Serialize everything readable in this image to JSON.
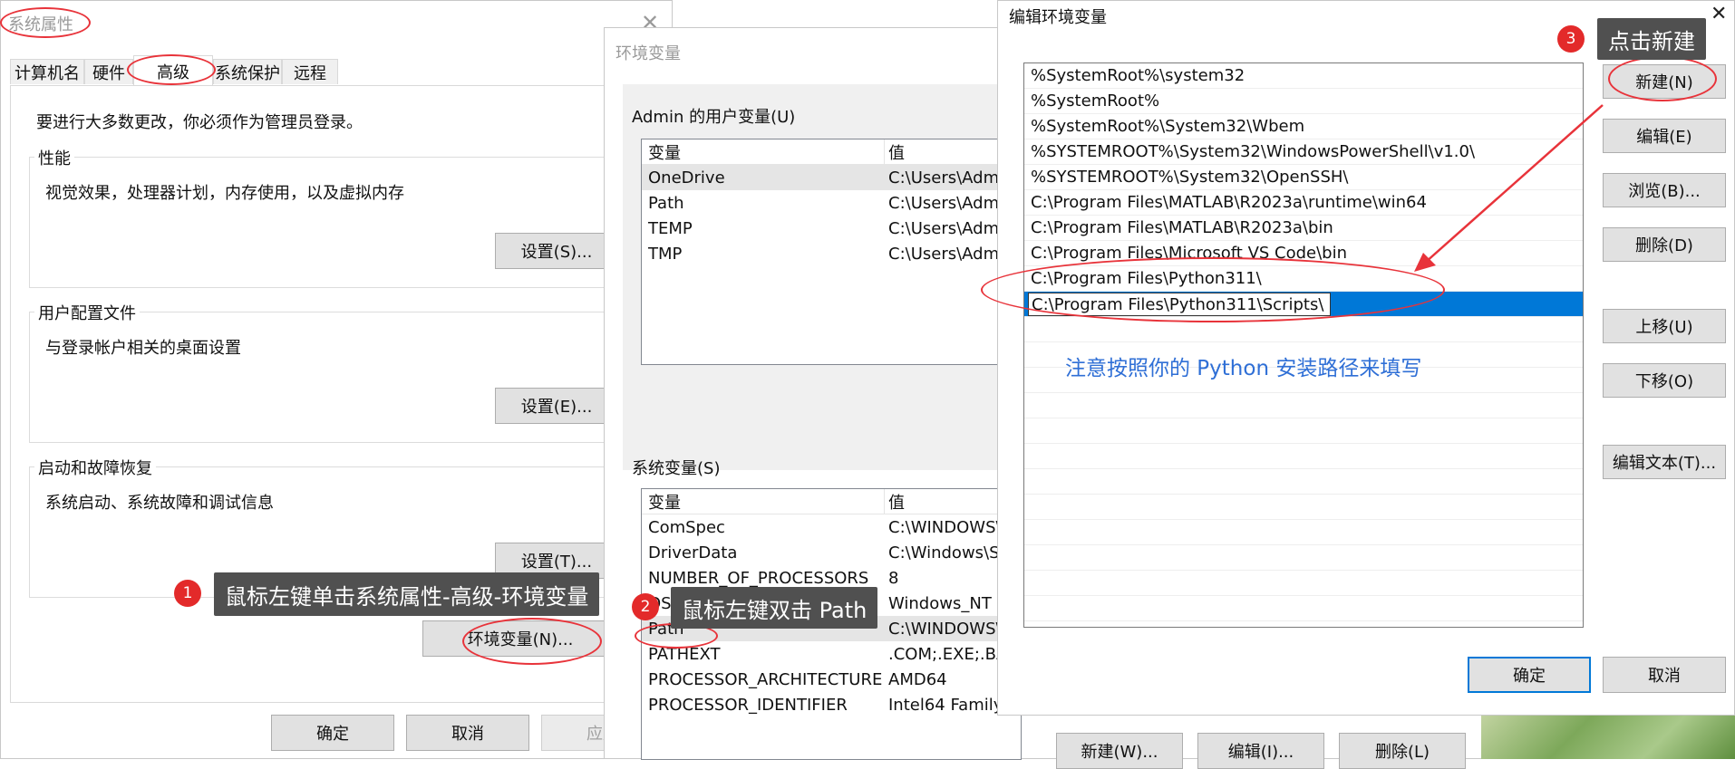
{
  "sysprops": {
    "title": "系统属性",
    "tabs": [
      "计算机名",
      "硬件",
      "高级",
      "系统保护",
      "远程"
    ],
    "admin_note": "要进行大多数更改，你必须作为管理员登录。",
    "perf_label": "性能",
    "perf_desc": "视觉效果，处理器计划，内存使用，以及虚拟内存",
    "perf_btn": "设置(S)...",
    "profile_label": "用户配置文件",
    "profile_desc": "与登录帐户相关的桌面设置",
    "profile_btn": "设置(E)...",
    "startup_label": "启动和故障恢复",
    "startup_desc": "系统启动、系统故障和调试信息",
    "startup_btn": "设置(T)...",
    "env_btn": "环境变量(N)...",
    "ok": "确定",
    "cancel": "取消",
    "apply": "应用"
  },
  "envvars": {
    "title": "环境变量",
    "user_label": "Admin 的用户变量(U)",
    "col_var": "变量",
    "col_val": "值",
    "user_rows": [
      {
        "name": "OneDrive",
        "value": "C:\\Users\\Adm"
      },
      {
        "name": "Path",
        "value": "C:\\Users\\Adm"
      },
      {
        "name": "TEMP",
        "value": "C:\\Users\\Adm"
      },
      {
        "name": "TMP",
        "value": "C:\\Users\\Adm"
      }
    ],
    "sys_label": "系统变量(S)",
    "sys_rows": [
      {
        "name": "ComSpec",
        "value": "C:\\WINDOWS\\"
      },
      {
        "name": "DriverData",
        "value": "C:\\Windows\\S"
      },
      {
        "name": "NUMBER_OF_PROCESSORS",
        "value": "8"
      },
      {
        "name": "OS",
        "value": "Windows_NT"
      },
      {
        "name": "Path",
        "value": "C:\\WINDOWS\\"
      },
      {
        "name": "PATHEXT",
        "value": ".COM;.EXE;.BA"
      },
      {
        "name": "PROCESSOR_ARCHITECTURE",
        "value": "AMD64"
      },
      {
        "name": "PROCESSOR_IDENTIFIER",
        "value": "Intel64 Family"
      }
    ],
    "new_btn": "新建(W)...",
    "edit_btn": "编辑(I)...",
    "delete_btn": "删除(L)"
  },
  "editenv": {
    "title": "编辑环境变量",
    "paths": [
      "%SystemRoot%\\system32",
      "%SystemRoot%",
      "%SystemRoot%\\System32\\Wbem",
      "%SYSTEMROOT%\\System32\\WindowsPowerShell\\v1.0\\",
      "%SYSTEMROOT%\\System32\\OpenSSH\\",
      "C:\\Program Files\\MATLAB\\R2023a\\runtime\\win64",
      "C:\\Program Files\\MATLAB\\R2023a\\bin",
      "C:\\Program Files\\Microsoft VS Code\\bin",
      "C:\\Program Files\\Python311\\"
    ],
    "editing_value": "C:\\Program Files\\Python311\\Scripts\\",
    "note": "注意按照你的 Python 安装路径来填写",
    "new_btn": "新建(N)",
    "edit_btn": "编辑(E)",
    "browse_btn": "浏览(B)...",
    "delete_btn": "删除(D)",
    "up_btn": "上移(U)",
    "down_btn": "下移(O)",
    "edit_text_btn": "编辑文本(T)...",
    "ok": "确定",
    "cancel": "取消"
  },
  "annotations": {
    "step1_num": "1",
    "step1_text": "鼠标左键单击系统属性-高级-环境变量",
    "step2_num": "2",
    "step2_text": "鼠标左键双击 Path",
    "step3_num": "3",
    "step3_text": "点击新建",
    "accent_red": "#e8333a",
    "note_blue": "#2f6fd6",
    "selection_blue": "#0078d7"
  }
}
